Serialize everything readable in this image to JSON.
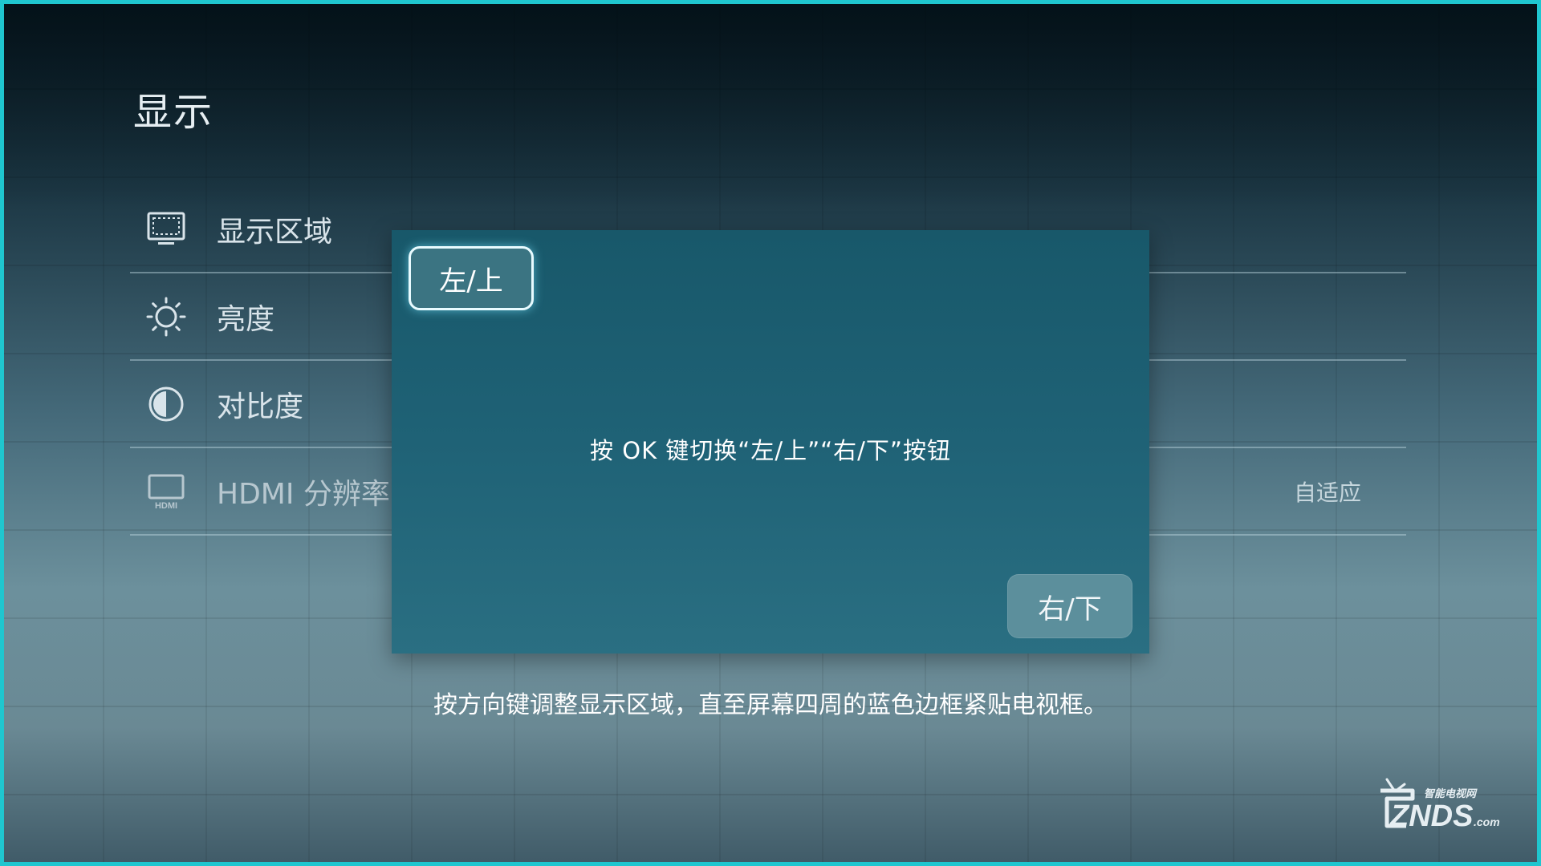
{
  "page": {
    "title": "显示",
    "accent_frame_color": "#1fc6cf"
  },
  "menu": {
    "items": [
      {
        "label": "显示区域",
        "icon": "screen-area-icon",
        "value": ""
      },
      {
        "label": "亮度",
        "icon": "brightness-icon",
        "value": ""
      },
      {
        "label": "对比度",
        "icon": "contrast-icon",
        "value": ""
      },
      {
        "label": "HDMI 分辨率",
        "icon": "hdmi-icon",
        "value": "自适应"
      }
    ]
  },
  "dialog": {
    "left_button_label": "左/上",
    "right_button_label": "右/下",
    "message": "按 OK 键切换“左/上”“右/下”按钮",
    "focused_button": "左/上"
  },
  "hint": {
    "text": "按方向键调整显示区域，直至屏幕四周的蓝色边框紧贴电视框。"
  },
  "watermark": {
    "brand": "ZNDS",
    "suffix": ".com",
    "tagline": "智能电视网"
  }
}
